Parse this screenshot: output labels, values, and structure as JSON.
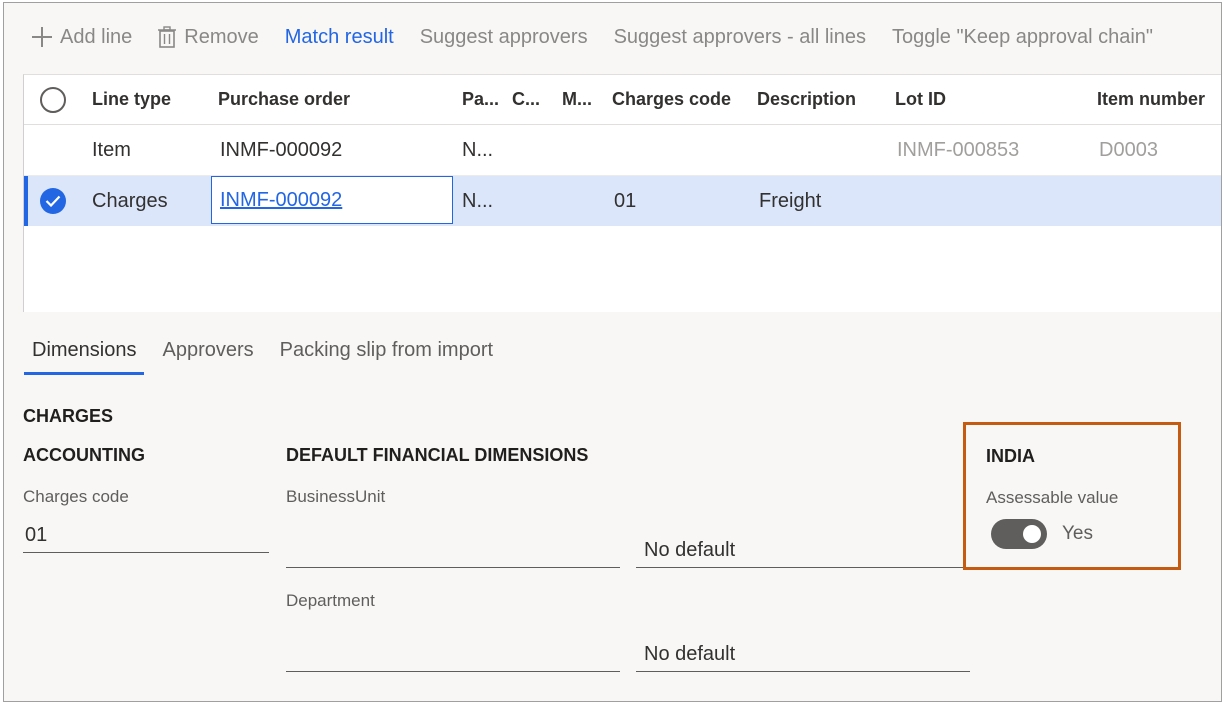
{
  "toolbar": {
    "add_line": "Add line",
    "remove": "Remove",
    "match_result": "Match result",
    "suggest_approvers": "Suggest approvers",
    "suggest_approvers_all": "Suggest approvers - all lines",
    "toggle_keep": "Toggle \"Keep approval chain\""
  },
  "grid": {
    "columns": [
      "Line type",
      "Purchase order",
      "Pa...",
      "C...",
      "M...",
      "Charges code",
      "Description",
      "Lot ID",
      "Item number"
    ],
    "rows": [
      {
        "line_type": "Item",
        "purchase_order": "INMF-000092",
        "pa": "N...",
        "c": "",
        "m": "",
        "charges_code": "",
        "description": "",
        "lot_id": "INMF-000853",
        "item_number": "D0003"
      },
      {
        "line_type": "Charges",
        "purchase_order": "INMF-000092",
        "pa": "N...",
        "c": "",
        "m": "",
        "charges_code": "01",
        "description": "Freight",
        "lot_id": "",
        "item_number": ""
      }
    ]
  },
  "tabs": [
    "Dimensions",
    "Approvers",
    "Packing slip from import"
  ],
  "details": {
    "charges_heading": "CHARGES",
    "accounting_heading": "ACCOUNTING",
    "charges_code_label": "Charges code",
    "charges_code_value": "01",
    "dfd_heading": "DEFAULT FINANCIAL DIMENSIONS",
    "business_unit_label": "BusinessUnit",
    "business_unit_value": "",
    "business_unit_default": "No default",
    "department_label": "Department",
    "department_value": "",
    "department_default": "No default",
    "india_heading": "INDIA",
    "assessable_label": "Assessable value",
    "assessable_value": "Yes"
  },
  "colors": {
    "accent": "#2266e3",
    "selected_row": "#dbe6fa",
    "highlight_box": "#c55a11"
  }
}
